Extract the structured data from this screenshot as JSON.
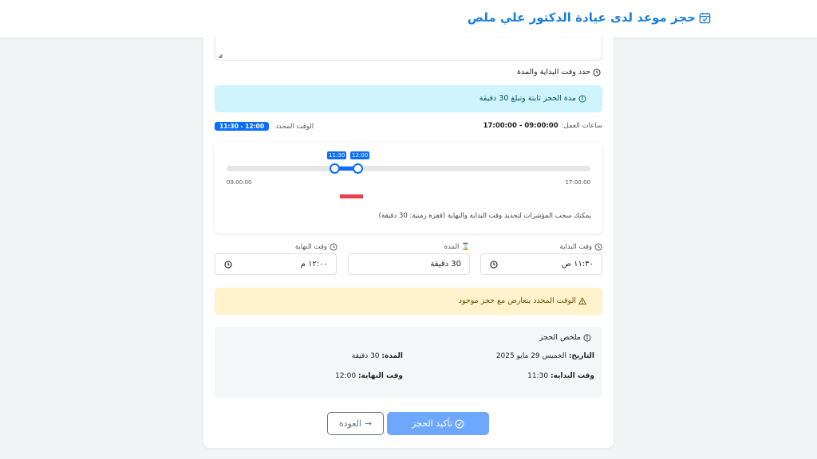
{
  "header": {
    "title": "حجز موعد لدى عيادة الدكتور علي ملص",
    "icon": "calendar-check-icon"
  },
  "section": {
    "title": "حدد وقت البداية والمدة"
  },
  "info": {
    "text": "مدة الحجز ثابتة وتبلغ 30 دقيقة"
  },
  "work_hours": {
    "label": "ساعات العمل:",
    "value": "09:00:00 - 17:00:00"
  },
  "selected": {
    "label": "الوقت المحدد",
    "value": "11:30 - 12:00"
  },
  "slider": {
    "start_label": "09:00:00",
    "end_label": "17:00:00",
    "thumb_start_label": "11:30",
    "thumb_end_label": "12:00",
    "hint": "يمكنك سحب المؤشرات لتحديد وقت البداية والنهاية (قفزة زمنية: 30 دقيقة)"
  },
  "fields": {
    "start": {
      "label": "وقت البداية",
      "value": "١١:٣٠ ص"
    },
    "duration": {
      "label": "المدة",
      "value": "30 دقيقة"
    },
    "end": {
      "label": "وقت النهاية",
      "value": "١٢:٠٠ م"
    }
  },
  "warning": {
    "text": "الوقت المحدد يتعارض مع حجز موجود"
  },
  "summary": {
    "title": "ملخص الحجز",
    "date_label": "التاريخ:",
    "date_value": "الخميس 29 مايو 2025",
    "duration_label": "المدة:",
    "duration_value": "30 دقيقة",
    "start_label": "وقت البداية:",
    "start_value": "11:30",
    "end_label": "وقت النهاية:",
    "end_value": "12:00"
  },
  "buttons": {
    "confirm": "تأكيد الحجز",
    "back": "العودة"
  },
  "colors": {
    "primary": "#0d6efd",
    "header_text": "#1d7fd8",
    "info_bg": "#cff4fc",
    "warning_bg": "#fff3cd",
    "conflict": "#e0414a"
  }
}
